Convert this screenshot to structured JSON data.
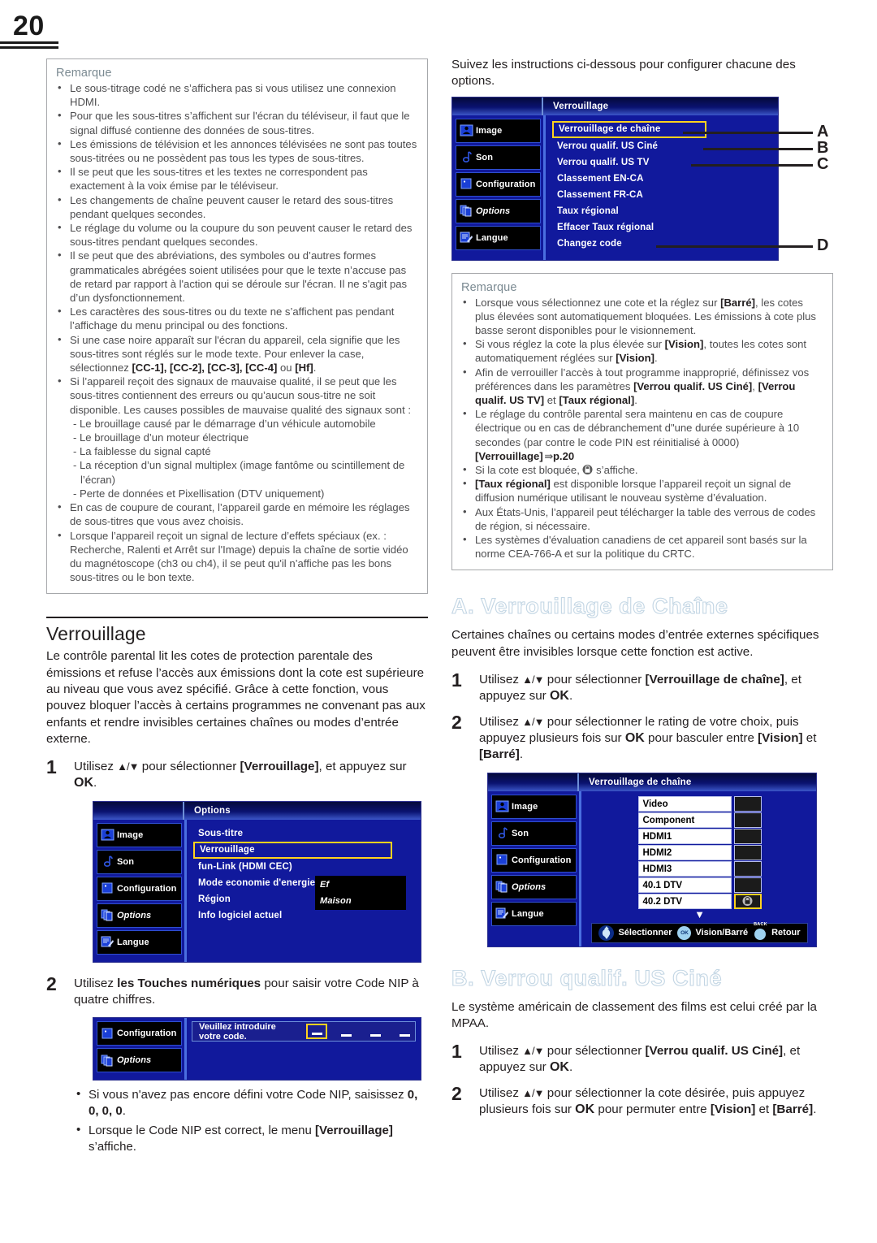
{
  "page": {
    "number": "20"
  },
  "left": {
    "note": {
      "title": "Remarque",
      "items": [
        "Le sous-titrage codé ne s’affichera pas si vous utilisez une connexion HDMI.",
        "Pour que les sous-titres s’affichent sur l'écran du téléviseur, il faut que le signal diffusé contienne des données de sous-titres.",
        "Les émissions de télévision et les annonces télévisées ne sont pas toutes sous-titrées ou ne possèdent pas tous les types de sous-titres.",
        "Il se peut que les sous-titres et les textes ne correspondent pas exactement à la voix émise par le téléviseur.",
        "Les changements de chaîne peuvent causer le retard des sous-titres pendant quelques secondes.",
        "Le réglage du volume ou la coupure du son peuvent causer le retard des sous-titres pendant quelques secondes.",
        "Il se peut que des abréviations, des symboles ou d’autres formes grammaticales abrégées soient utilisées pour que le texte n’accuse pas de retard par rapport à l'action qui se déroule sur l'écran. Il ne s'agit pas d’un dysfonctionnement.",
        "Les caractères des sous-titres ou du texte ne s’affichent pas pendant l’affichage du menu principal ou des fonctions."
      ],
      "item_cc_pre": "Si une case noire apparaît sur l'écran du appareil, cela signifie que les sous-titres sont réglés sur le mode texte. Pour enlever la case, sélectionnez ",
      "item_cc_codes": "[CC-1], [CC-2], [CC-3], [CC-4]",
      "item_cc_mid": " ou ",
      "item_cc_hf": "[Hf]",
      "item_cc_end": ".",
      "item_signal": "Si l’appareil reçoit des signaux de mauvaise qualité, il se peut que les sous-titres contiennent des erreurs ou qu’aucun sous-titre ne soit disponible. Les causes possibles de mauvaise qualité des signaux sont :",
      "sub_items": [
        "- Le brouillage causé par le démarrage d’un véhicule automobile",
        "- Le brouillage d’un moteur électrique",
        "- La faiblesse du signal capté",
        "- La réception d’un signal multiplex (image fantôme ou scintillement de l’écran)",
        "- Perte de données et Pixellisation (DTV uniquement)"
      ],
      "items_tail": [
        "En cas de coupure de courant, l’appareil garde en mémoire les réglages de sous-titres que vous avez choisis.",
        "Lorsque l’appareil reçoit un signal de lecture d’effets spéciaux (ex. : Recherche, Ralenti et Arrêt sur l'Image) depuis la chaîne de sortie vidéo du magnétoscope (ch3 ou ch4), il se peut qu'il n’affiche pas les bons sous-titres ou le bon texte."
      ]
    },
    "verrouillage": {
      "heading": "Verrouillage",
      "intro": "Le contrôle parental lit les cotes de protection parentale des émissions et refuse l’accès aux émissions dont la cote est supérieure au niveau que vous avez spécifié. Grâce à cette fonction, vous pouvez bloquer l’accès à certains programmes ne convenant pas aux enfants et rendre invisibles certaines chaînes ou modes d’entrée externe.",
      "step1_num": "1",
      "step1_a": "Utilisez ",
      "step1_arrows": "▲/▼",
      "step1_b": " pour sélectionner ",
      "step1_bold": "[Verrouillage]",
      "step1_c": ", et appuyez sur ",
      "step1_ok": "OK",
      "step1_d": ".",
      "step2_num": "2",
      "step2_a": "Utilisez ",
      "step2_bold": "les Touches numériques",
      "step2_b": " pour saisir votre Code NIP à quatre chiffres.",
      "bullets": [
        {
          "pre": "Si vous n'avez pas encore défini votre Code NIP, saisissez ",
          "bold": "0, 0, 0, 0",
          "post": "."
        },
        {
          "pre": "Lorsque le Code NIP est correct, le menu ",
          "bold": "[Verrouillage]",
          "post": " s’affiche."
        }
      ]
    },
    "osd_options": {
      "title": "Options",
      "sidebar": [
        "Image",
        "Son",
        "Configuration",
        "Options",
        "Langue"
      ],
      "rows": [
        {
          "label": "Sous-titre",
          "value": "",
          "selected": false
        },
        {
          "label": "Verrouillage",
          "value": "",
          "selected": true
        },
        {
          "label": "fun-Link (HDMI CEC)",
          "value": "",
          "selected": false
        },
        {
          "label": "Mode economie d'energie",
          "value": "Ef",
          "selected": false
        },
        {
          "label": "Région",
          "value": "Maison",
          "selected": false
        },
        {
          "label": "Info logiciel actuel",
          "value": "",
          "selected": false
        }
      ]
    },
    "osd_pin": {
      "sidebar": [
        "Configuration",
        "Options"
      ],
      "prompt": "Veuillez introduire votre code."
    }
  },
  "right": {
    "intro": "Suivez les instructions ci-dessous pour configurer chacune des options.",
    "osd_lock": {
      "title": "Verrouillage",
      "sidebar": [
        "Image",
        "Son",
        "Configuration",
        "Options",
        "Langue"
      ],
      "rows": [
        {
          "label": "Verrouillage de chaîne",
          "selected": true,
          "letter": "A"
        },
        {
          "label": "Verrou qualif. US Ciné",
          "selected": false,
          "letter": "B"
        },
        {
          "label": "Verrou qualif. US TV",
          "selected": false,
          "letter": "C"
        },
        {
          "label": "Classement EN-CA",
          "selected": false,
          "letter": ""
        },
        {
          "label": "Classement FR-CA",
          "selected": false,
          "letter": ""
        },
        {
          "label": "Taux régional",
          "selected": false,
          "letter": ""
        },
        {
          "label": "Effacer Taux régional",
          "selected": false,
          "letter": ""
        },
        {
          "label": "Changez code",
          "selected": false,
          "letter": "D"
        }
      ]
    },
    "note": {
      "title": "Remarque",
      "b1_a": "Lorsque vous sélectionnez une cote et la réglez sur ",
      "b1_bold": "[Barré]",
      "b1_b": ", les cotes plus élevées sont automatiquement bloquées. Les émissions à cote plus basse seront disponibles pour le visionnement.",
      "b2_a": "Si vous réglez la cote la plus élevée sur ",
      "b2_bold1": "[Vision]",
      "b2_b": ", toutes les cotes sont automatiquement réglées sur ",
      "b2_bold2": "[Vision]",
      "b2_c": ".",
      "b3_a": "Afin de verrouiller l’accès à tout programme inapproprié, définissez vos préférences dans les paramètres ",
      "b3_bold1": "[Verrou qualif. US Ciné]",
      "b3_sep1": ", ",
      "b3_bold2": "[Verrou qualif. US TV]",
      "b3_sep2": " et ",
      "b3_bold3": "[Taux régional]",
      "b3_end": ".",
      "b4_a": "Le réglage du contrôle parental sera maintenu en cas de coupure électrique ou en cas de débranchement d\"une durée supérieure à 10 secondes (par contre le code PIN est réinitialisé à 0000)",
      "b4_bold": "[Verrouillage]",
      "b4_page": "p.20",
      "b5_a": "Si la cote est bloquée, ",
      "b5_b": " s’affiche.",
      "b6_bold": "[Taux régional]",
      "b6_a": " est disponible lorsque l’appareil reçoit un signal de diffusion numérique utilisant le nouveau système d’évaluation.",
      "b7": "Aux États-Unis, l’appareil peut télécharger la table des verrous de codes de région, si nécessaire.",
      "b8": "Les systèmes d'évaluation canadiens de cet appareil sont basés sur la norme CEA-766-A et sur la politique du CRTC."
    },
    "sectionA": {
      "heading": "A. Verrouillage de Chaîne",
      "intro": "Certaines chaînes ou certains modes d’entrée externes spécifiques peuvent être invisibles lorsque cette fonction est active.",
      "step1_num": "1",
      "step1_a": "Utilisez ",
      "step1_arrows": "▲/▼",
      "step1_b": " pour sélectionner ",
      "step1_bold": "[Verrouillage de chaîne]",
      "step1_c": ", et appuyez sur ",
      "step1_ok": "OK",
      "step1_d": ".",
      "step2_num": "2",
      "step2_a": "Utilisez ",
      "step2_arrows": "▲/▼",
      "step2_b": " pour sélectionner le rating de votre choix, puis appuyez plusieurs fois sur ",
      "step2_ok": "OK",
      "step2_c": " pour basculer entre ",
      "step2_bold1": "[Vision]",
      "step2_d": " et ",
      "step2_bold2": "[Barré]",
      "step2_e": "."
    },
    "osd_channel": {
      "title": "Verrouillage de chaîne",
      "sidebar": [
        "Image",
        "Son",
        "Configuration",
        "Options",
        "Langue"
      ],
      "channels": [
        {
          "name": "Video",
          "locked": false,
          "selected": false
        },
        {
          "name": "Component",
          "locked": false,
          "selected": false
        },
        {
          "name": "HDMI1",
          "locked": false,
          "selected": false
        },
        {
          "name": "HDMI2",
          "locked": false,
          "selected": false
        },
        {
          "name": "HDMI3",
          "locked": false,
          "selected": false
        },
        {
          "name": "40.1 DTV",
          "locked": false,
          "selected": false
        },
        {
          "name": "40.2 DTV",
          "locked": true,
          "selected": true
        }
      ],
      "bar": {
        "select": "Sélectionner",
        "ok_label": "OK",
        "vision": "Vision/Barré",
        "back_label": "BACK",
        "back": "Retour"
      }
    },
    "sectionB": {
      "heading": "B. Verrou qualif. US Ciné",
      "intro": "Le système américain de classement des films est celui créé par la MPAA.",
      "step1_num": "1",
      "step1_a": "Utilisez ",
      "step1_arrows": "▲/▼",
      "step1_b": " pour sélectionner ",
      "step1_bold": "[Verrou qualif. US Ciné]",
      "step1_c": ", et appuyez sur ",
      "step1_ok": "OK",
      "step1_d": ".",
      "step2_num": "2",
      "step2_a": "Utilisez ",
      "step2_arrows": "▲/▼",
      "step2_b": " pour sélectionner la cote désirée, puis appuyez plusieurs fois sur ",
      "step2_ok": "OK",
      "step2_c": " pour permuter entre ",
      "step2_bold1": "[Vision]",
      "step2_d": " et ",
      "step2_bold2": "[Barré]",
      "step2_e": "."
    }
  },
  "colors": {
    "osd_blue": "#11199c",
    "highlight_yellow": "#ffd21e",
    "note_title": "#7b8a92",
    "outline_head": "#c3d6e4"
  }
}
